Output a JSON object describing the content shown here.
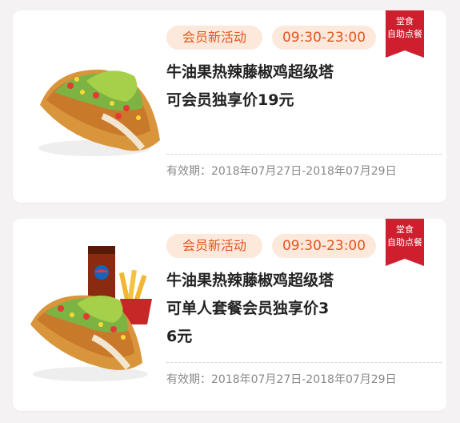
{
  "colors": {
    "accent": "#e4561e",
    "tag_bg": "#fde8dc",
    "ribbon": "#cf1f2e",
    "background": "#f4f2f2"
  },
  "coupons": [
    {
      "tag_member": "会员新活动",
      "tag_time": "09:30-23:00",
      "ribbon_line1": "堂食",
      "ribbon_line2": "自助点餐",
      "title": "牛油果热辣藤椒鸡超级塔可会员独享价19元",
      "validity": "有效期：2018年07月27日-2018年07月29日",
      "image": "avocado-taco"
    },
    {
      "tag_member": "会员新活动",
      "tag_time": "09:30-23:00",
      "ribbon_line1": "堂食",
      "ribbon_line2": "自助点餐",
      "title": "牛油果热辣藤椒鸡超级塔可单人套餐会员独享价36元",
      "validity": "有效期：2018年07月27日-2018年07月29日",
      "image": "avocado-taco-combo-with-cola-and-fries"
    }
  ]
}
